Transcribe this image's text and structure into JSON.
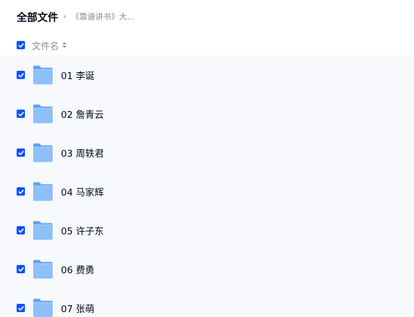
{
  "breadcrumb": {
    "root": "全部文件",
    "current": "《靠谱讲书》大..."
  },
  "header": {
    "column_name": "文件名",
    "select_all_checked": true
  },
  "files": [
    {
      "name": "01 李诞",
      "checked": true,
      "icon": "folder-icon"
    },
    {
      "name": "02 詹青云",
      "checked": true,
      "icon": "folder-icon"
    },
    {
      "name": "03 周轶君",
      "checked": true,
      "icon": "folder-icon"
    },
    {
      "name": "04 马家辉",
      "checked": true,
      "icon": "folder-icon"
    },
    {
      "name": "05 许子东",
      "checked": true,
      "icon": "folder-icon"
    },
    {
      "name": "06 费勇",
      "checked": true,
      "icon": "folder-icon"
    },
    {
      "name": "07 张萌",
      "checked": true,
      "icon": "folder-icon"
    }
  ],
  "colors": {
    "accent": "#0d53ff",
    "folder": "#7cb6f5",
    "list_background": "#f7f9fc",
    "muted_text": "#878c9c"
  }
}
